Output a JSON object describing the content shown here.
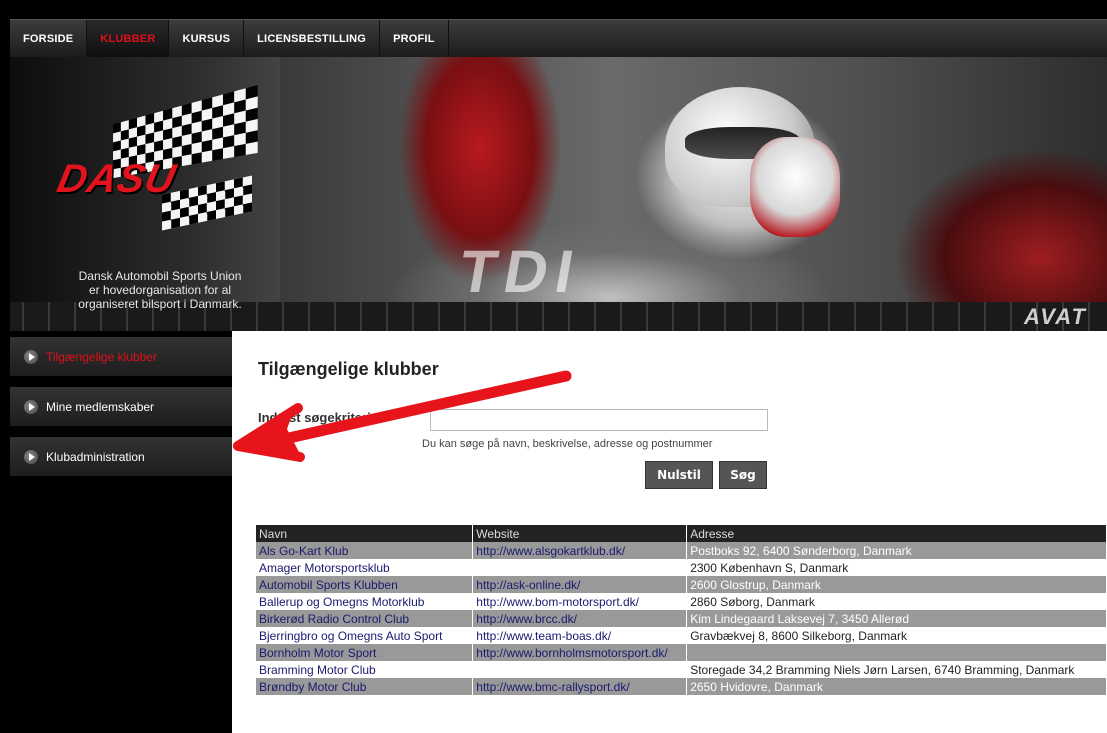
{
  "nav": {
    "items": [
      {
        "label": "FORSIDE",
        "active": false
      },
      {
        "label": "KLUBBER",
        "active": true
      },
      {
        "label": "KURSUS",
        "active": false
      },
      {
        "label": "LICENSBESTILLING",
        "active": false
      },
      {
        "label": "PROFIL",
        "active": false
      }
    ]
  },
  "banner": {
    "logo_text": "DASU",
    "tagline_lines": [
      "Dansk Automobil Sports Union",
      "er hovedorganisation for al",
      "organiseret bilsport i Danmark."
    ],
    "photo_text": "TDI",
    "brand_strip_text": "AVAT"
  },
  "sidebar": {
    "items": [
      {
        "label": "Tilgængelige klubber",
        "active": true
      },
      {
        "label": "Mine medlemskaber",
        "active": false
      },
      {
        "label": "Klubadministration",
        "active": false
      }
    ]
  },
  "main": {
    "title": "Tilgængelige klubber",
    "search_label": "Indtast søgekriterier",
    "search_value": "",
    "search_hint": "Du kan søge på navn, beskrivelse, adresse og postnummer",
    "reset_label": "Nulstil",
    "search_label_btn": "Søg"
  },
  "table": {
    "headers": [
      "Navn",
      "Website",
      "Adresse"
    ],
    "rows": [
      [
        "Als Go-Kart Klub",
        "http://www.alsgokartklub.dk/",
        "Postboks 92, 6400 Sønderborg, Danmark"
      ],
      [
        "Amager Motorsportsklub",
        "",
        "2300 København S, Danmark"
      ],
      [
        "Automobil Sports Klubben",
        "http://ask-online.dk/",
        "2600 Glostrup, Danmark"
      ],
      [
        "Ballerup og Omegns Motorklub",
        "http://www.bom-motorsport.dk/",
        "2860 Søborg, Danmark"
      ],
      [
        "Birkerød Radio Control Club",
        "http://www.brcc.dk/",
        "Kim Lindegaard Laksevej 7, 3450 Allerød"
      ],
      [
        "Bjerringbro og Omegns Auto Sport",
        "http://www.team-boas.dk/",
        "Gravbækvej 8, 8600 Silkeborg, Danmark"
      ],
      [
        "Bornholm Motor Sport",
        "http://www.bornholmsmotorsport.dk/",
        ""
      ],
      [
        "Bramming Motor Club",
        "",
        "Storegade 34,2 Bramming Niels Jørn Larsen, 6740 Bramming, Danmark"
      ],
      [
        "Brøndby Motor Club",
        "http://www.bmc-rallysport.dk/",
        "2650 Hvidovre, Danmark"
      ]
    ]
  },
  "colors": {
    "accent_red": "#e0101a",
    "arrow_red": "#e8141c"
  }
}
